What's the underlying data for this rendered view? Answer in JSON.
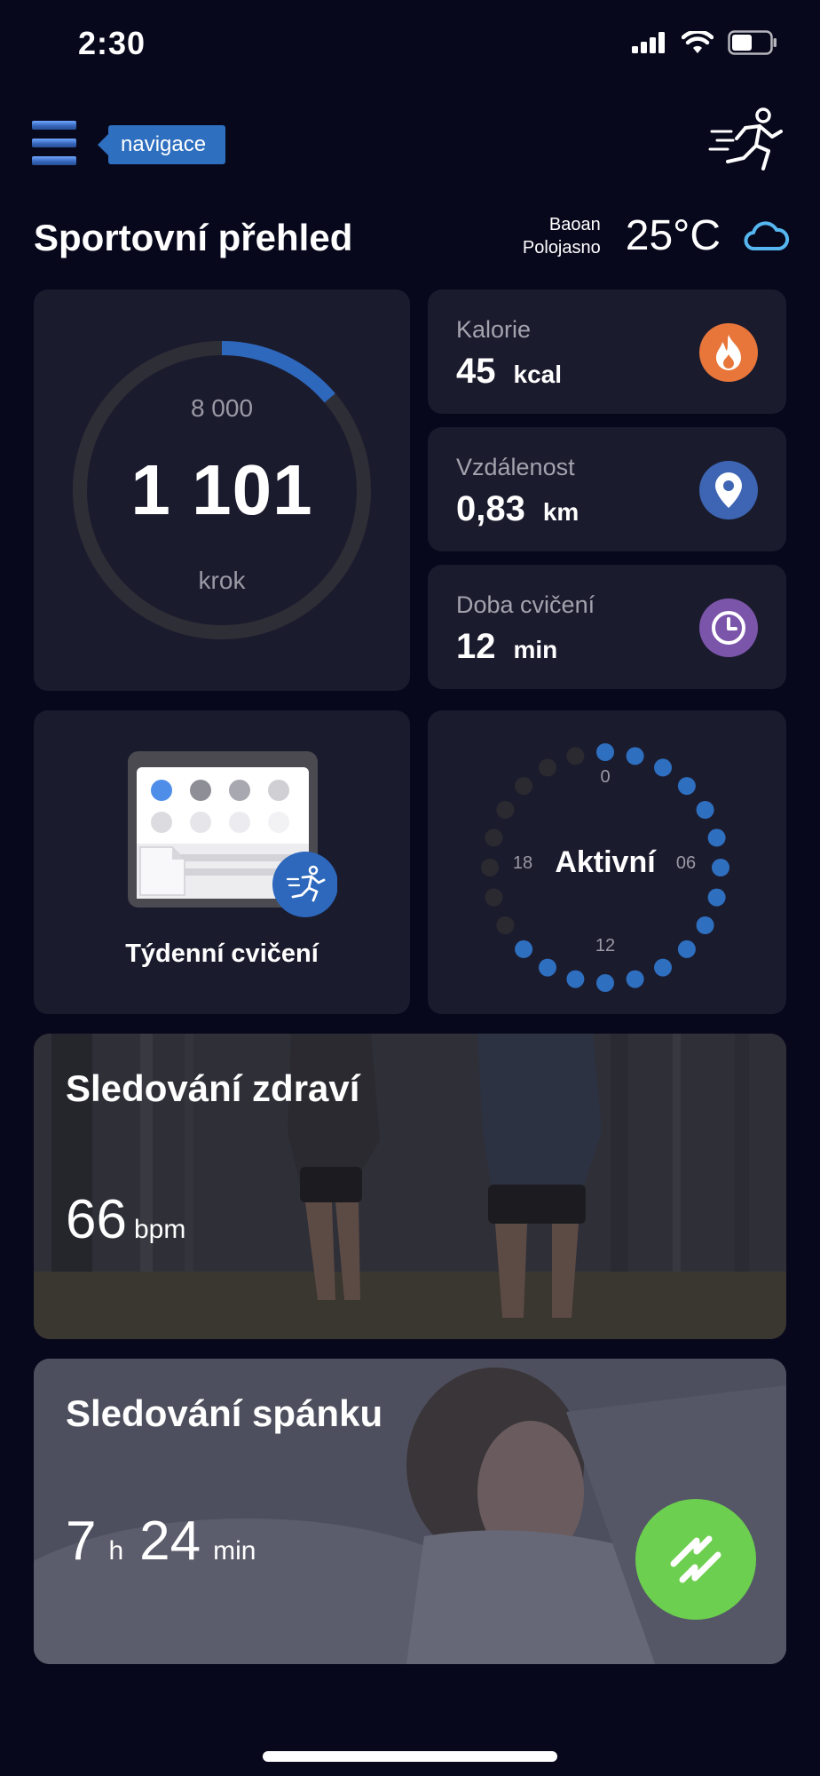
{
  "status_bar": {
    "time": "2:30",
    "icons": [
      "signal-icon",
      "wifi-icon",
      "battery-icon"
    ]
  },
  "header": {
    "menu_icon": "hamburger-menu-icon",
    "nav_tag_label": "navigace",
    "logo_icon": "running-person-icon"
  },
  "title": "Sportovní přehled",
  "weather": {
    "location": "Baoan",
    "condition": "Polojasno",
    "temperature": "25°C",
    "icon": "cloud-icon"
  },
  "steps": {
    "goal": "8 000",
    "value": "1 101",
    "unit": "krok",
    "progress_fraction": 0.1376
  },
  "stats": [
    {
      "label": "Kalorie",
      "value": "45",
      "unit": "kcal",
      "icon": "flame-icon",
      "color": "#e8763a"
    },
    {
      "label": "Vzdálenost",
      "value": "0,83",
      "unit": "km",
      "icon": "location-pin-icon",
      "color": "#3d65b3"
    },
    {
      "label": "Doba cvičení",
      "value": "12",
      "unit": "min",
      "icon": "clock-icon",
      "color": "#7b55aa"
    }
  ],
  "weekly": {
    "label": "Týdenní cvičení",
    "icon": "weekly-calendar-icon"
  },
  "activity": {
    "label": "Aktivní",
    "hour_labels": [
      "0",
      "06",
      "12",
      "18"
    ],
    "active_hours": [
      0,
      1,
      2,
      3,
      4,
      5,
      6,
      7,
      8,
      9,
      10,
      11,
      12,
      13,
      14,
      15
    ],
    "active_color": "#2e6fc0",
    "inactive_color": "#2a2a30"
  },
  "health": {
    "title": "Sledování zdraví",
    "value": "66",
    "unit": "bpm"
  },
  "sleep": {
    "title": "Sledování spánku",
    "hours": "7",
    "hours_unit": "h",
    "minutes": "24",
    "minutes_unit": "min",
    "fab_icon": "swap-arrows-icon",
    "fab_color": "#6ccf4f"
  }
}
